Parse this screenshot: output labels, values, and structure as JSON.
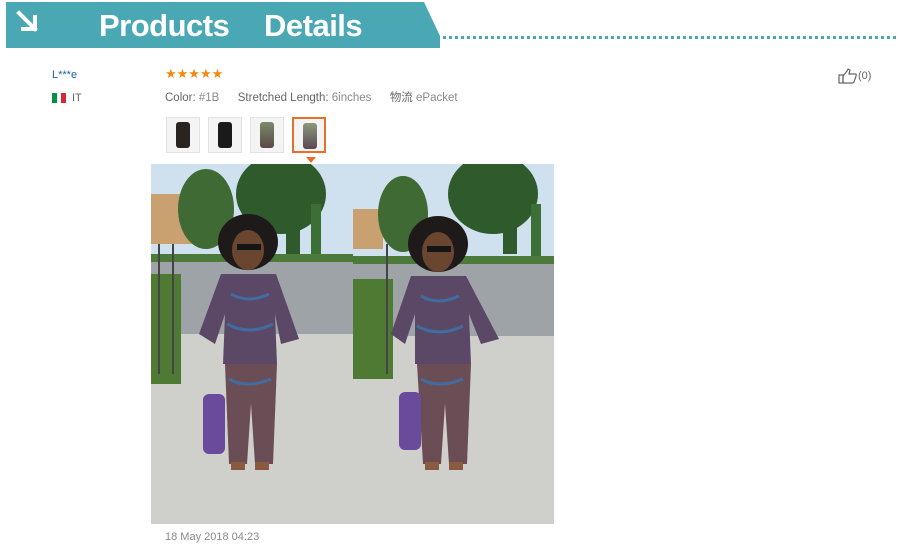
{
  "header": {
    "title_word1": "Products",
    "title_word2": "Details",
    "arrow_icon": "arrow-down-right-icon"
  },
  "reviewer": {
    "name": "L***e",
    "country": "IT",
    "flag_colors": [
      "#009246",
      "#ffffff",
      "#ce2b37"
    ]
  },
  "review": {
    "rating": 5,
    "stars": "★★★★★",
    "color_label": "Color:",
    "color_value": "#1B",
    "length_label": "Stretched Length:",
    "length_value": "6inches",
    "shipping_label": "物流",
    "shipping_value": "ePacket",
    "thumbnails_count": 4,
    "selected_thumbnail": 4,
    "date": "18 May 2018 04:23"
  },
  "helpful": {
    "count": "(0)",
    "icon": "thumbs-up-icon"
  },
  "colors": {
    "banner": "#4aa8b4",
    "accent": "#e6702a",
    "star": "#f28a0f",
    "link": "#1f5fa8"
  }
}
